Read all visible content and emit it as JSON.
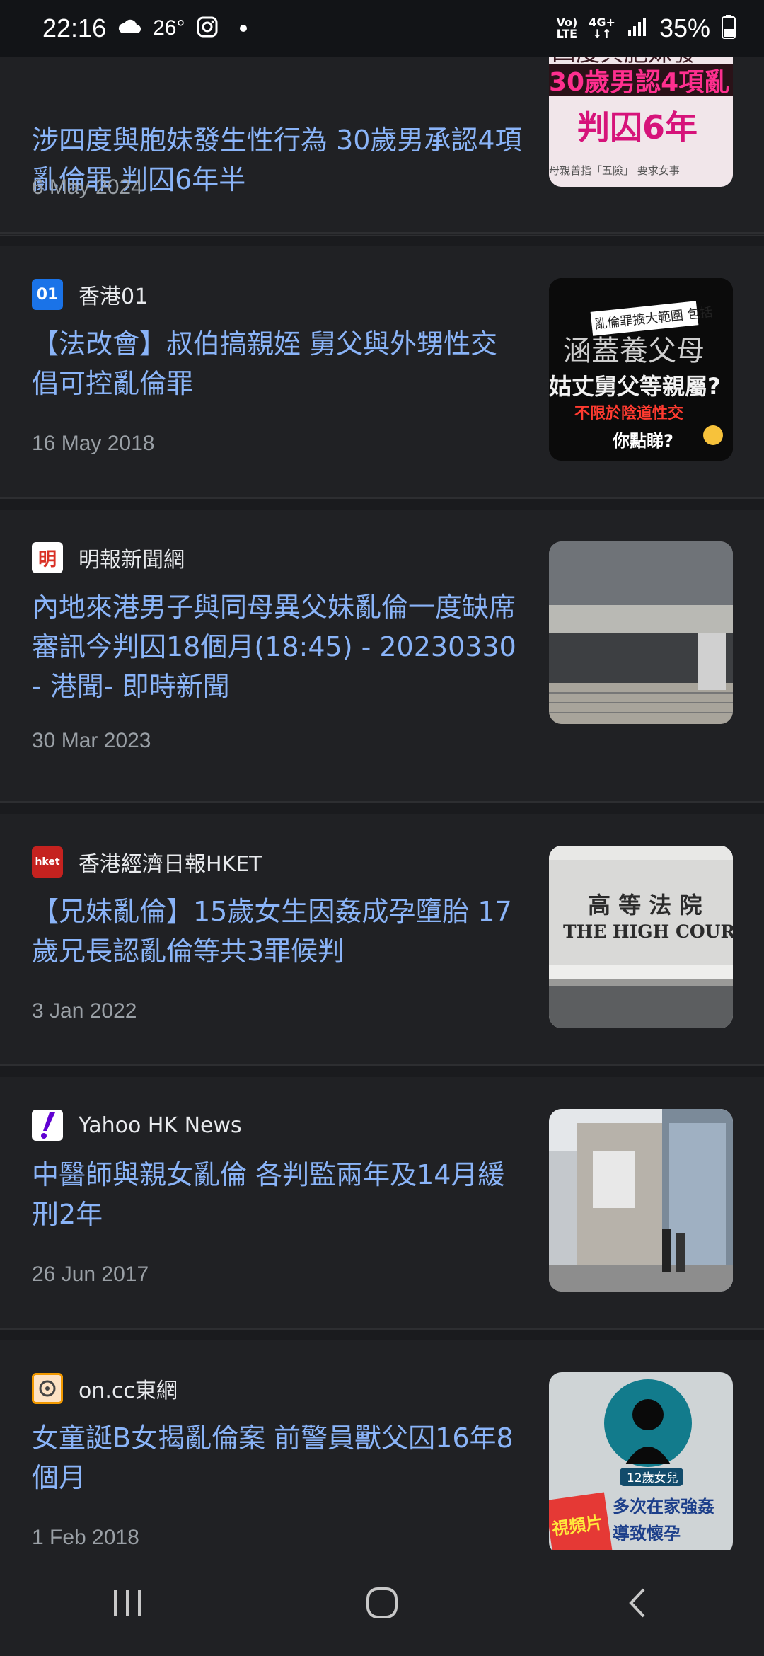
{
  "status_bar": {
    "time": "22:16",
    "temperature": "26°",
    "battery": "35%",
    "net_top": "Vo)",
    "net_bottom": "LTE",
    "net_gen": "4G+"
  },
  "articles": [
    {
      "source": "",
      "headline": "涉四度與胞妹發生性行為 30歲男承認4項亂倫罪 判囚6年半",
      "date": "6 May 2024",
      "thumb_text": [
        "四度與胞妹發",
        "30歲男認4項亂",
        "判囚6年",
        "母親曾指「五險」 要求女事"
      ]
    },
    {
      "source": "香港01",
      "logo_text": "01",
      "logo_color": "#1a73e8",
      "headline": "【法改會】叔伯搞親姪 舅父與外甥性交 倡可控亂倫罪",
      "date": "16 May 2018",
      "thumb_text": [
        "亂倫罪擴大範圍 包括",
        "涵蓋養父母",
        "姑丈舅父等親屬?",
        "不限於陰道性交",
        "你點睇?"
      ]
    },
    {
      "source": "明報新聞網",
      "logo_text": "明",
      "logo_color": "#d93025",
      "headline": "內地來港男子與同母異父妹亂倫一度缺席審訊今判囚18個月(18:45) - 20230330 - 港聞- 即時新聞",
      "date": "30 Mar 2023",
      "thumb_text": []
    },
    {
      "source": "香港經濟日報HKET",
      "logo_text": "hket",
      "logo_color": "#c5221f",
      "headline": "【兄妹亂倫】15歲女生因姦成孕墮胎 17歲兄長認亂倫等共3罪候判",
      "date": "3 Jan 2022",
      "thumb_text": [
        "高 等 法 院",
        "THE HIGH COURT"
      ]
    },
    {
      "source": "Yahoo HK News",
      "logo_text": "!",
      "logo_color": "#ffffff",
      "headline": "中醫師與親女亂倫 各判監兩年及14月緩刑2年",
      "date": "26 Jun 2017",
      "thumb_text": []
    },
    {
      "source": "on.cc東網",
      "logo_text": "on",
      "logo_color": "#f29900",
      "headline": "女童誕B女揭亂倫案 前警員獸父囚16年8個月",
      "date": "1 Feb 2018",
      "thumb_text": [
        "12歲女兒",
        "多次在家強姦",
        "導致懷孕",
        "視頻片"
      ]
    }
  ],
  "colors": {
    "background": "#202124",
    "headline": "#8ab4f8",
    "meta": "#9aa0a6"
  }
}
